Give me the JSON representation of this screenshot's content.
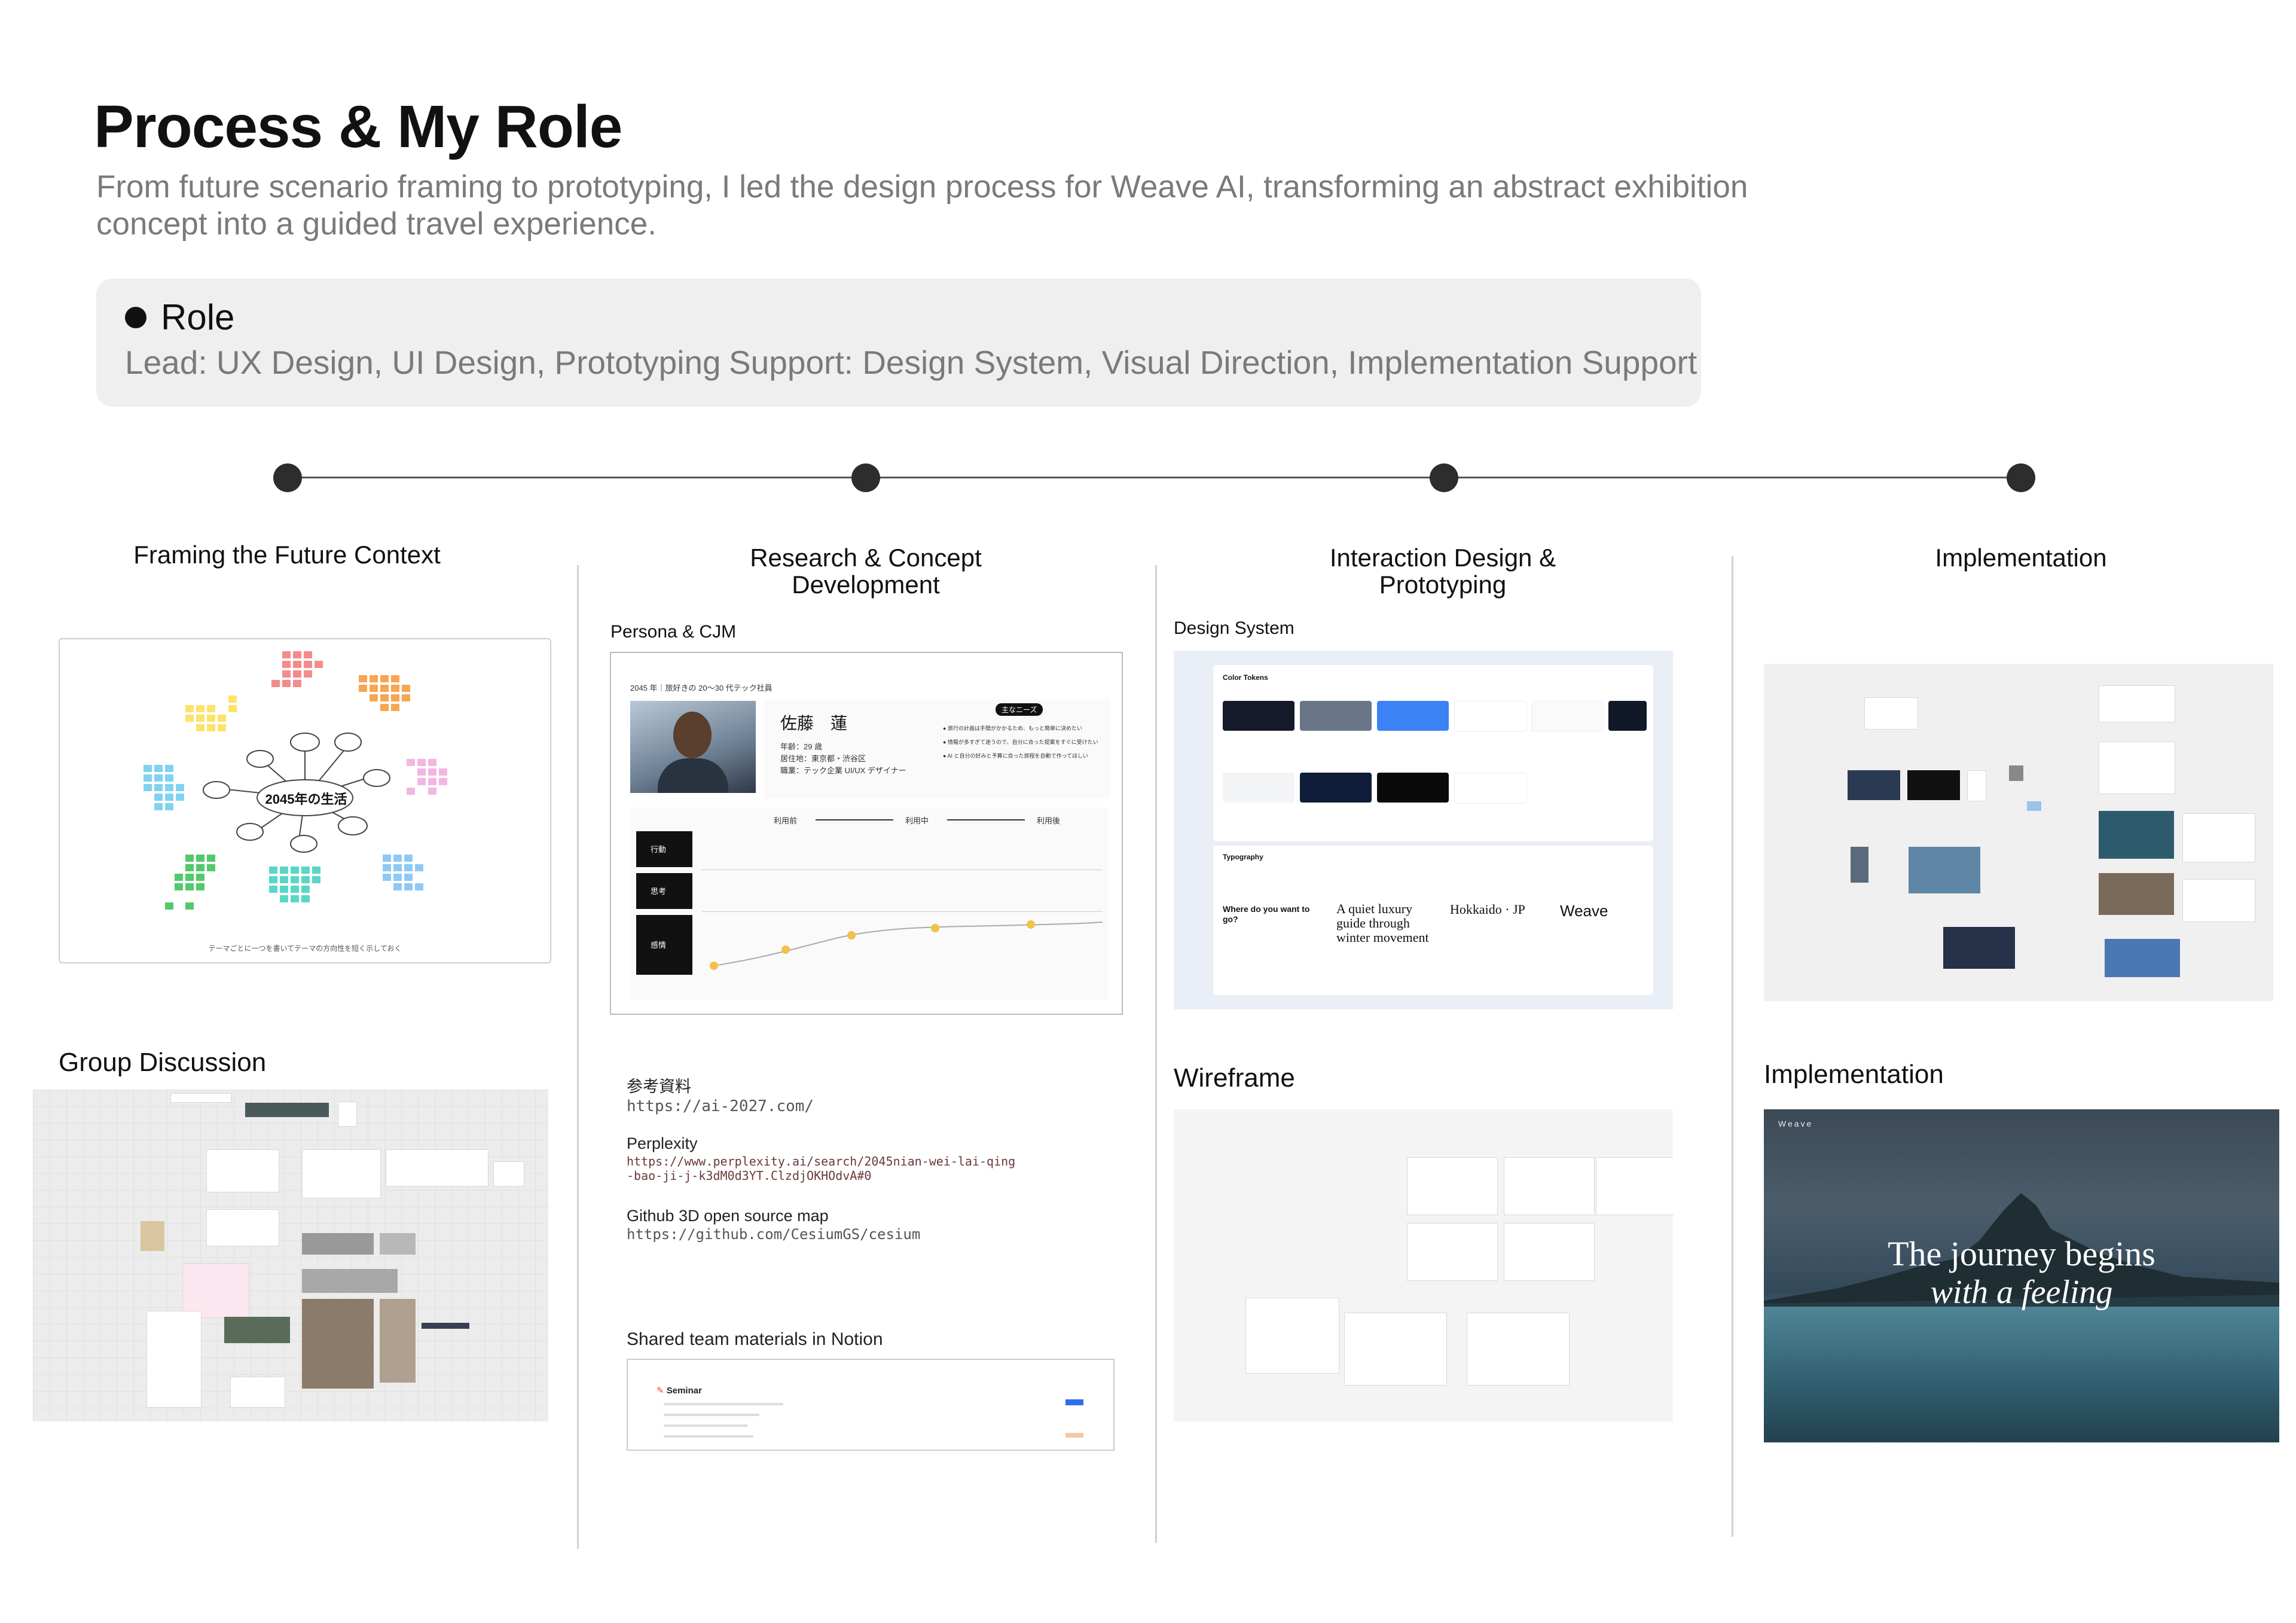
{
  "header": {
    "title": "Process & My Role",
    "subtitle": "From future scenario framing to prototyping, I led the design process for Weave AI, transforming an abstract exhibition concept into a guided travel experience."
  },
  "role": {
    "heading": "Role",
    "lead": "Lead: UX Design, UI Design, Prototyping",
    "support": "Support: Design System, Visual Direction, Implementation Support"
  },
  "phases": [
    {
      "title": "Framing the Future Context"
    },
    {
      "title": "Research & Concept Development"
    },
    {
      "title": "Interaction Design & Prototyping"
    },
    {
      "title": "Implementation"
    }
  ],
  "col1": {
    "mindmap_center": "2045年の生活",
    "mindmap_caption": "テーマごとに一つを書いてテーマの方向性を短く示しておく",
    "group_discussion": "Group Discussion"
  },
  "col2": {
    "persona_label": "Persona & CJM",
    "persona": {
      "tag": "2045 年｜旅好きの 20〜30 代テック社員",
      "name": "佐藤　蓮",
      "age": "年齢：29 歳",
      "location": "居住地：東京都・渋谷区",
      "job": "職業：テック企業 UI/UX デザイナー",
      "needs_badge": "主なニーズ",
      "needs": [
        "旅行の計画は手間がかかるため、もっと簡単に決めたい",
        "情報が多すぎて迷うので、自分に合った提案をすぐに受けたい",
        "AI と自分の好みと予算に合った旅程を自動で作ってほしい"
      ],
      "stages": [
        "利用前",
        "利用中",
        "利用後"
      ],
      "rows": [
        "行動",
        "思考",
        "感情"
      ]
    },
    "references_heading": "参考資料",
    "refs": [
      {
        "title": "",
        "url": "https://ai-2027.com/"
      },
      {
        "title": "Perplexity",
        "url": "https://www.perplexity.ai/search/2045nian-wei-lai-qing-bao-ji-j-k3dM0d3YT.ClzdjOKHOdvA#0"
      },
      {
        "title": "Github 3D open source map",
        "url": "https://github.com/CesiumGS/cesium"
      }
    ],
    "notion_label": "Shared team materials in Notion",
    "notion_title": "Seminar"
  },
  "col3": {
    "design_system_label": "Design System",
    "color_tokens": "Color Tokens",
    "typography": "Typography",
    "type_samples": [
      "Where do you want to go?",
      "A quiet luxury guide through winter movement",
      "Hokkaido · JP",
      "Weave"
    ],
    "wireframe_label": "Wireframe"
  },
  "col4": {
    "implementation_label": "Implementation",
    "hero_brand": "Weave",
    "hero_line1": "The journey begins",
    "hero_line2": "with a feeling"
  }
}
